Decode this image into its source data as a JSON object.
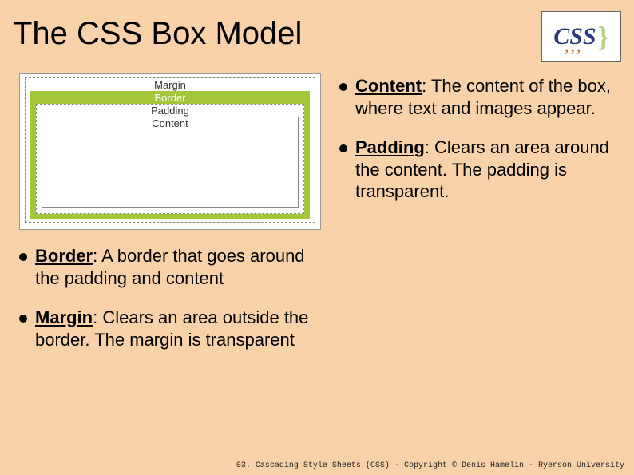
{
  "title": "The CSS Box Model",
  "logo": {
    "text": "CSS",
    "brace": "}",
    "dots": ",,,"
  },
  "diagram": {
    "margin_label": "Margin",
    "border_label": "Border",
    "padding_label": "Padding",
    "content_label": "Content"
  },
  "right_bullets": [
    {
      "term": "Content",
      "rest": ": The content of the box, where text and images appear."
    },
    {
      "term": "Padding",
      "rest": ": Clears an area around the content. The padding is transparent."
    }
  ],
  "left_bullets": [
    {
      "term": "Border",
      "rest": ": A border that goes around the padding and content"
    },
    {
      "term": "Margin",
      "rest": ": Clears an area outside the border. The margin is transparent"
    }
  ],
  "footer": "03. Cascading Style Sheets (CSS) - Copyright © Denis Hamelin - Ryerson University"
}
